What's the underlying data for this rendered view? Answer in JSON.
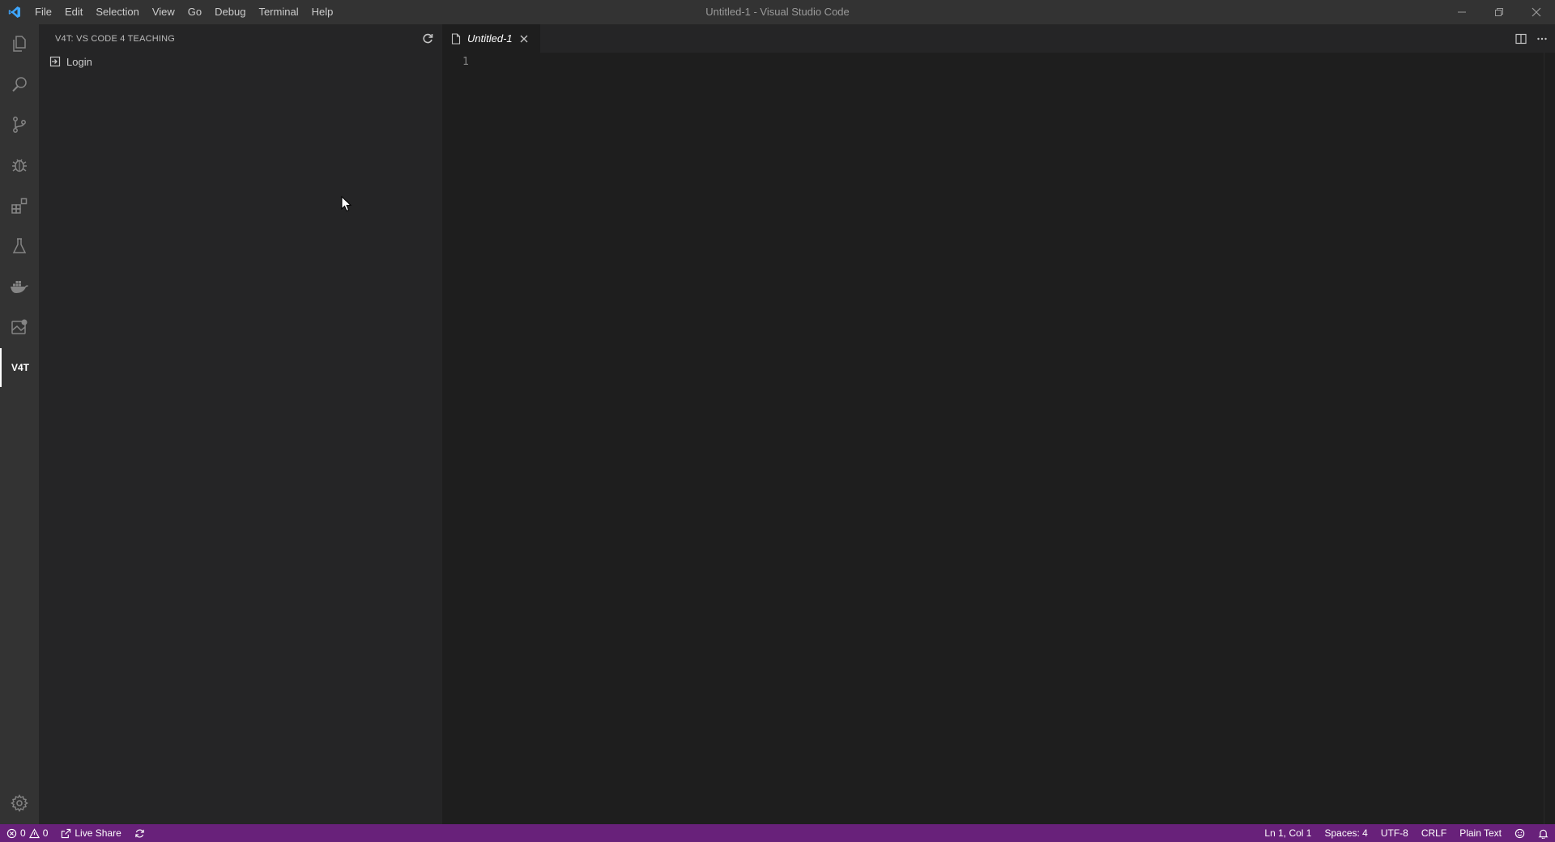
{
  "titlebar": {
    "window_title": "Untitled-1 - Visual Studio Code",
    "menu": [
      "File",
      "Edit",
      "Selection",
      "View",
      "Go",
      "Debug",
      "Terminal",
      "Help"
    ]
  },
  "activitybar": {
    "items": [
      {
        "name": "explorer",
        "icon": "files-icon"
      },
      {
        "name": "search",
        "icon": "search-icon"
      },
      {
        "name": "source-control",
        "icon": "source-control-icon"
      },
      {
        "name": "debug",
        "icon": "bug-icon"
      },
      {
        "name": "extensions",
        "icon": "extensions-icon"
      },
      {
        "name": "test",
        "icon": "flask-icon"
      },
      {
        "name": "docker",
        "icon": "docker-icon"
      },
      {
        "name": "remote",
        "icon": "remote-explorer-icon"
      },
      {
        "name": "v4t",
        "label": "V4T",
        "active": true
      }
    ],
    "manage_icon": "gear-icon"
  },
  "sidebar": {
    "title": "V4T: VS CODE 4 TEACHING",
    "items": [
      {
        "label": "Login",
        "icon": "sign-in-icon"
      }
    ]
  },
  "editor": {
    "tab_label": "Untitled-1",
    "line_number": "1"
  },
  "statusbar": {
    "errors": "0",
    "warnings": "0",
    "live_share": "Live Share",
    "position": "Ln 1, Col 1",
    "spaces": "Spaces: 4",
    "encoding": "UTF-8",
    "eol": "CRLF",
    "language": "Plain Text",
    "accent_color": "#68217a"
  }
}
